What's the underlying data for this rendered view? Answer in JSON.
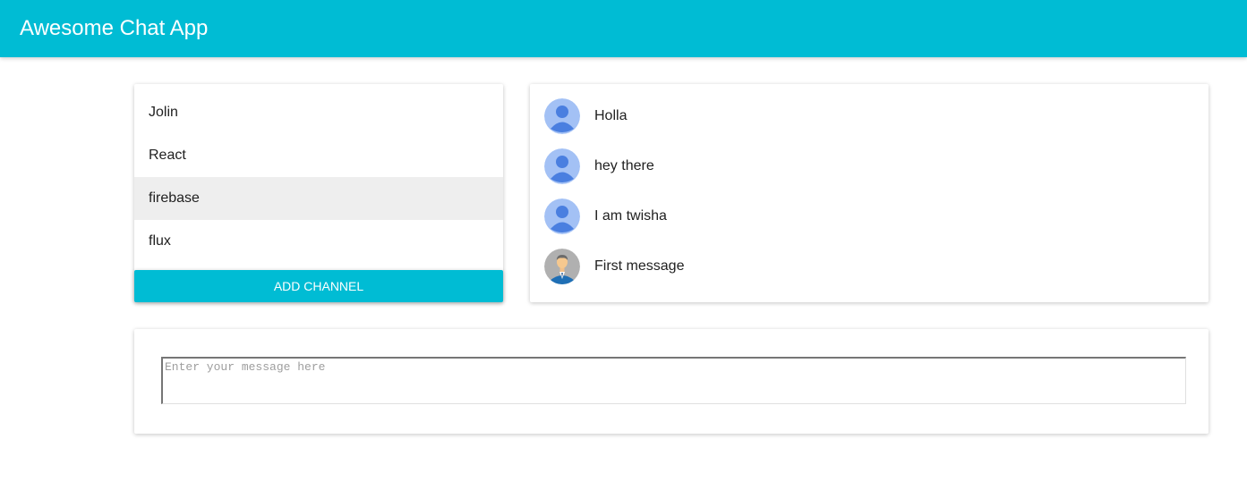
{
  "appbar": {
    "title": "Awesome Chat App",
    "color": "#00BCD4"
  },
  "channels": {
    "items": [
      {
        "label": "Jolin",
        "selected": false
      },
      {
        "label": "React",
        "selected": false
      },
      {
        "label": "firebase",
        "selected": true
      },
      {
        "label": "flux",
        "selected": false
      }
    ],
    "add_button_label": "ADD CHANNEL"
  },
  "messages": {
    "items": [
      {
        "text": "Holla",
        "avatar": "default-user-icon"
      },
      {
        "text": "hey there",
        "avatar": "default-user-icon"
      },
      {
        "text": "I am twisha",
        "avatar": "default-user-icon"
      },
      {
        "text": "First message",
        "avatar": "businessman-avatar-icon"
      }
    ]
  },
  "compose": {
    "placeholder": "Enter your message here",
    "value": ""
  }
}
